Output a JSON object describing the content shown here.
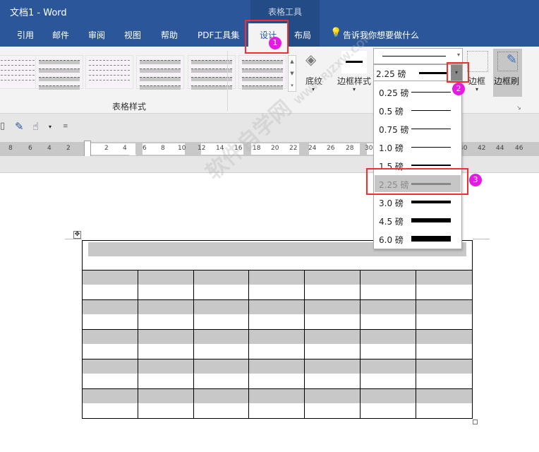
{
  "window": {
    "title": "文档1  -  Word",
    "context_tab_group": "表格工具"
  },
  "tabs": [
    "引用",
    "邮件",
    "审阅",
    "视图",
    "帮助",
    "PDF工具集",
    "设计",
    "布局"
  ],
  "tell_me": "告诉我你想要做什么",
  "ribbon": {
    "table_styles_label": "表格样式",
    "shading_label": "底纹",
    "border_styles_label": "边框样式",
    "line_weight_value": "2.25 磅",
    "borders_label": "边框",
    "border_painter_label": "边框刷"
  },
  "ruler_numbers": [
    "8",
    "6",
    "4",
    "2",
    "2",
    "4",
    "6",
    "8",
    "10",
    "12",
    "14",
    "16",
    "18",
    "20",
    "22",
    "24",
    "26",
    "28",
    "30",
    "40",
    "42",
    "44",
    "46"
  ],
  "weight_menu": [
    {
      "label": "0.25 磅",
      "weight": 0.25
    },
    {
      "label": "0.5 磅",
      "weight": 0.5
    },
    {
      "label": "0.75 磅",
      "weight": 0.75
    },
    {
      "label": "1.0 磅",
      "weight": 1.0
    },
    {
      "label": "1.5 磅",
      "weight": 1.5
    },
    {
      "label": "2.25 磅",
      "weight": 2.25,
      "selected": true
    },
    {
      "label": "3.0 磅",
      "weight": 3.0
    },
    {
      "label": "4.5 磅",
      "weight": 4.5
    },
    {
      "label": "6.0 磅",
      "weight": 6.0
    }
  ],
  "annotations": [
    "1",
    "2",
    "3"
  ],
  "watermark": "软件自学网 WWW.RJZXW.COM",
  "colors": {
    "brand": "#2b579a",
    "highlight": "#f0302f",
    "badge": "#e51ae5"
  }
}
